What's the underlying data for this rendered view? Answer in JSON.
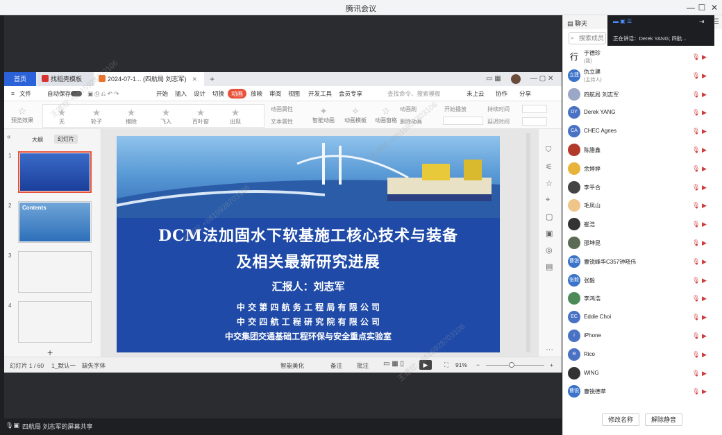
{
  "window": {
    "title": "腾讯会议",
    "minimize": "—",
    "maximize": "☐",
    "close": "✕"
  },
  "wps": {
    "tabs": [
      {
        "label": "首页"
      },
      {
        "label": "找稻壳模板"
      },
      {
        "label": "2024-07-1... (四航局 刘志军)"
      }
    ],
    "add_tab": "+",
    "menus": [
      "文件",
      "自动保存",
      "开始",
      "插入",
      "设计",
      "切换",
      "动画",
      "放映",
      "审阅",
      "视图",
      "开发工具",
      "会员专享",
      "查找命令、搜索模板",
      "未上云",
      "协作",
      "分享"
    ],
    "active_menu": "动画",
    "ribbon": {
      "preview": "预览效果",
      "effects": [
        "无",
        "轮子",
        "擦除",
        "飞入",
        "百叶窗",
        "出现"
      ],
      "anim_attr": "动画属性",
      "text_attr": "文本属性",
      "smart_anim": "智能动画",
      "anim_template": "动画模板",
      "anim_window": "动画窗格",
      "delete_anim": "删除动画",
      "anim_brush": "动画刷",
      "start_play": "开始播放",
      "duration": "持续时间",
      "delay": "延迟时间"
    },
    "panel_tabs": [
      "大纲",
      "幻灯片"
    ],
    "thumbs": [
      "1",
      "2",
      "3",
      "4"
    ],
    "thumb_contents": "Contents",
    "slide": {
      "title_line1": "DCM法加固水下软基施工核心技术与装备",
      "title_line2": "及相关最新研究进展",
      "reporter": "汇报人：刘志军",
      "org1": "中 交 第 四 航 务 工 程 局 有 限 公 司",
      "org2": "中 交 四 航 工 程 研 究 院 有 限 公 司",
      "org3": "中交集团交通基础工程环保与安全重点实验室"
    },
    "status": {
      "page": "幻灯片 1 / 60",
      "theme": "1_默认一",
      "font": "缺失字体",
      "beautify": "智能美化",
      "notes": "备注",
      "comment": "批注",
      "zoom": "91%"
    }
  },
  "meeting_footer": "四航局 刘志军的屏幕共享",
  "sidebar": {
    "chat": "聊天",
    "search_placeholder": "搜索成员",
    "speaking": "正在讲话：Derek YANG; 四航...",
    "members": [
      {
        "name": "于德珍",
        "sub": "(我)",
        "avatar": "行",
        "color": "#ffffff"
      },
      {
        "name": "仇立建",
        "sub": "(主持人)",
        "avatar": "立建",
        "color": "#3a73c9"
      },
      {
        "name": "四航局 刘志军",
        "sub": "",
        "avatar": "",
        "color": "#9aa7c7"
      },
      {
        "name": "Derek YANG",
        "sub": "",
        "avatar": "DY",
        "color": "#4a72c4"
      },
      {
        "name": "CHEC Agnes",
        "sub": "",
        "avatar": "CA",
        "color": "#4a72c4"
      },
      {
        "name": "陈腊鑫",
        "sub": "",
        "avatar": "",
        "color": "#b23a2a"
      },
      {
        "name": "余婷婷",
        "sub": "",
        "avatar": "",
        "color": "#e7b33a"
      },
      {
        "name": "李平合",
        "sub": "",
        "avatar": "",
        "color": "#444"
      },
      {
        "name": "毛凤山",
        "sub": "",
        "avatar": "",
        "color": "#f0c58a"
      },
      {
        "name": "崔浩",
        "sub": "",
        "avatar": "",
        "color": "#333"
      },
      {
        "name": "邵坤昆",
        "sub": "",
        "avatar": "",
        "color": "#5c6b56"
      },
      {
        "name": "曹锐峰华C357钟晓伟",
        "sub": "",
        "avatar": "曹锐",
        "color": "#3a73c9"
      },
      {
        "name": "张毅",
        "sub": "",
        "avatar": "张毅",
        "color": "#3a73c9"
      },
      {
        "name": "李鸿浩",
        "sub": "",
        "avatar": "",
        "color": "#4d8a5a"
      },
      {
        "name": "Eddie Choi",
        "sub": "",
        "avatar": "EC",
        "color": "#4a72c4"
      },
      {
        "name": "iPhone",
        "sub": "",
        "avatar": "i",
        "color": "#4a72c4"
      },
      {
        "name": "Rico",
        "sub": "",
        "avatar": "R",
        "color": "#4a72c4"
      },
      {
        "name": "WING",
        "sub": "",
        "avatar": "",
        "color": "#333"
      },
      {
        "name": "曹锐德萃",
        "sub": "",
        "avatar": "曹锐",
        "color": "#3a73c9"
      }
    ],
    "rename_button": "修改名称",
    "unmute_all_button": "解除静音"
  },
  "watermark": "王德珍 +8615928703106",
  "colors": {
    "accent": "#2b62d9",
    "active_tab": "#e8523b",
    "slide_bg": "#1f4aa8",
    "muted_icon": "#d03a3a"
  }
}
